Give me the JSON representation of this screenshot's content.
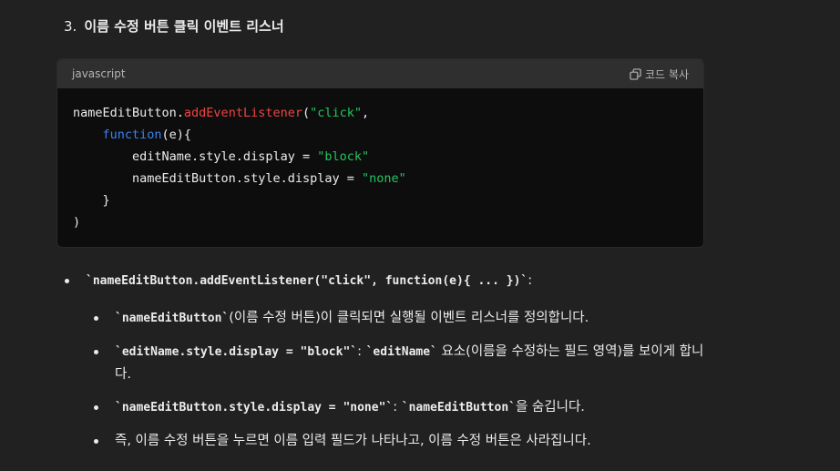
{
  "heading": {
    "number": "3.",
    "title": "이름 수정 버튼 클릭 이벤트 리스너"
  },
  "code_block": {
    "language": "javascript",
    "copy_label": "코드 복사",
    "lines": [
      [
        {
          "t": "nameEditButton.",
          "c": "plain"
        },
        {
          "t": "addEventListener",
          "c": "fn"
        },
        {
          "t": "(",
          "c": "plain"
        },
        {
          "t": "\"click\"",
          "c": "str"
        },
        {
          "t": ",",
          "c": "plain"
        }
      ],
      [
        {
          "t": "    ",
          "c": "plain"
        },
        {
          "t": "function",
          "c": "kw"
        },
        {
          "t": "(e){",
          "c": "plain"
        }
      ],
      [
        {
          "t": "        editName.style.display = ",
          "c": "plain"
        },
        {
          "t": "\"block\"",
          "c": "str"
        }
      ],
      [
        {
          "t": "        nameEditButton.style.display = ",
          "c": "plain"
        },
        {
          "t": "\"none\"",
          "c": "str"
        }
      ],
      [
        {
          "t": "    }",
          "c": "plain"
        }
      ],
      [
        {
          "t": ")",
          "c": "plain"
        }
      ]
    ]
  },
  "bullets": {
    "b1_code": "`nameEditButton.addEventListener(\"click\", function(e){ ... })`",
    "b1_text": ":",
    "b2_code": "`nameEditButton`",
    "b2_text": "(이름 수정 버튼)이 클릭되면 실행될 이벤트 리스너를 정의합니다.",
    "b3_code1": "`editName.style.display = \"block\"`",
    "b3_mid": ": ",
    "b3_code2": "`editName`",
    "b3_text": " 요소(이름을 수정하는 필드 영역)를 보이게 합니다.",
    "b4_code1": "`nameEditButton.style.display = \"none\"`",
    "b4_mid": ": ",
    "b4_code2": "`nameEditButton`",
    "b4_text": "을 숨깁니다.",
    "b5_text": "즉, 이름 수정 버튼을 누르면 이름 입력 필드가 나타나고, 이름 수정 버튼은 사라집니다."
  },
  "colors": {
    "background": "#212121",
    "code_bg": "#0d0d0d",
    "code_header_bg": "#2f2f2f",
    "token_function": "#ef4444",
    "token_string": "#22c55e",
    "token_keyword": "#3b82f6"
  }
}
